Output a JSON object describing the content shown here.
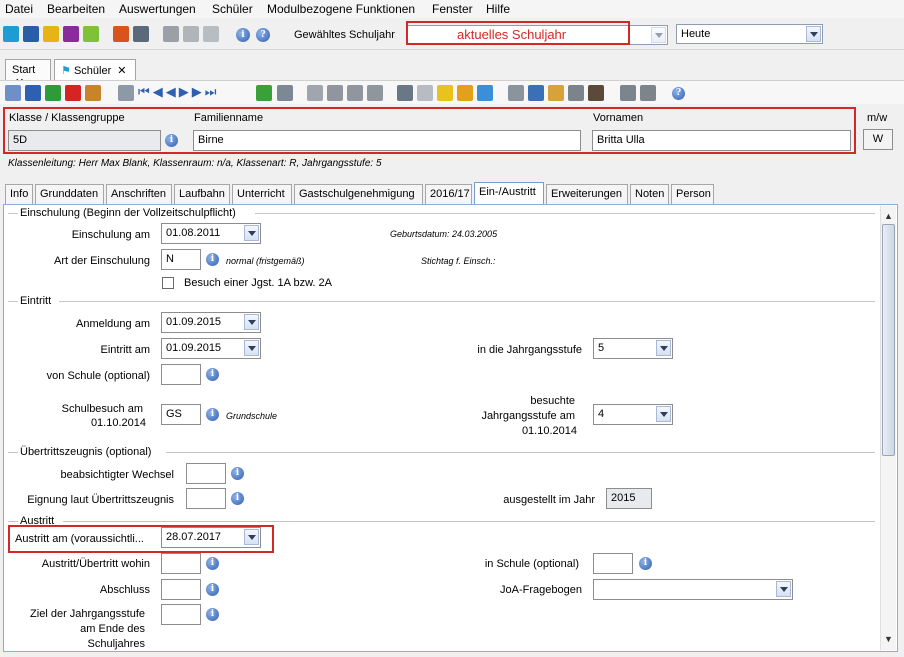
{
  "menu": [
    "Datei",
    "Bearbeiten",
    "Auswertungen",
    "Schüler",
    "Modulbezogene Funktionen",
    "Fenster",
    "Hilfe"
  ],
  "toolbar": {
    "schuljahr_label": "Gewähltes Schuljahr",
    "schuljahr_value": "aktuelles Schuljahr",
    "date_value": "Heute"
  },
  "tabs": {
    "start": "Start",
    "schueler": "Schüler"
  },
  "header": {
    "klasse_label": "Klasse / Klassengruppe",
    "klasse_value": "5D",
    "familienname_label": "Familienname",
    "familienname_value": "Birne",
    "vornamen_label": "Vornamen",
    "vornamen_value": "Britta Ulla",
    "mw_label": "m/w",
    "mw_value": "W",
    "info_line": "Klassenleitung: Herr Max Blank, Klassenraum: n/a, Klassenart: R, Jahrgangsstufe: 5"
  },
  "subtabs": [
    "Info",
    "Grunddaten",
    "Anschriften",
    "Laufbahn",
    "Unterricht",
    "Gastschulgenehmigung",
    "2016/17",
    "Ein-/Austritt",
    "Erweiterungen",
    "Noten",
    "Person"
  ],
  "einschulung": {
    "title": "Einschulung (Beginn der Vollzeitschulpflicht)",
    "am_label": "Einschulung am",
    "am_value": "01.08.2011",
    "geburtsdatum": "Geburtsdatum: 24.03.2005",
    "art_label": "Art der Einschulung",
    "art_value": "N",
    "art_note": "normal (fristgemäß)",
    "stichtag": "Stichtag f. Einsch.:",
    "checkbox_label": "Besuch einer Jgst. 1A bzw. 2A"
  },
  "eintritt": {
    "title": "Eintritt",
    "anmeldung_label": "Anmeldung am",
    "anmeldung_value": "01.09.2015",
    "eintritt_label": "Eintritt am",
    "eintritt_value": "01.09.2015",
    "jgst_label": "in die Jahrgangsstufe",
    "jgst_value": "5",
    "von_schule_label": "von Schule (optional)",
    "schulbesuch_label_1": "Schulbesuch am",
    "schulbesuch_label_2": "01.10.2014",
    "schulbesuch_value": "GS",
    "schulbesuch_note": "Grundschule",
    "besuchte_label_1": "besuchte",
    "besuchte_label_2": "Jahrgangsstufe am",
    "besuchte_label_3": "01.10.2014",
    "besuchte_value": "4"
  },
  "uebertritt": {
    "title": "Übertrittszeugnis (optional)",
    "wechsel_label": "beabsichtigter Wechsel",
    "eignung_label": "Eignung laut Übertrittszeugnis",
    "ausgestellt_label": "ausgestellt im Jahr",
    "ausgestellt_value": "2015"
  },
  "austritt": {
    "title": "Austritt",
    "am_label": "Austritt am (voraussichtli...",
    "am_value": "28.07.2017",
    "wohin_label": "Austritt/Übertritt wohin",
    "in_schule_label": "in Schule (optional)",
    "abschluss_label": "Abschluss",
    "joa_label": "JoA-Fragebogen",
    "ziel_label_1": "Ziel der Jahrgangsstufe",
    "ziel_label_2": "am Ende des",
    "ziel_label_3": "Schuljahres"
  },
  "colors": {
    "highlight": "#d62727",
    "accent": "#2f5fb0"
  }
}
